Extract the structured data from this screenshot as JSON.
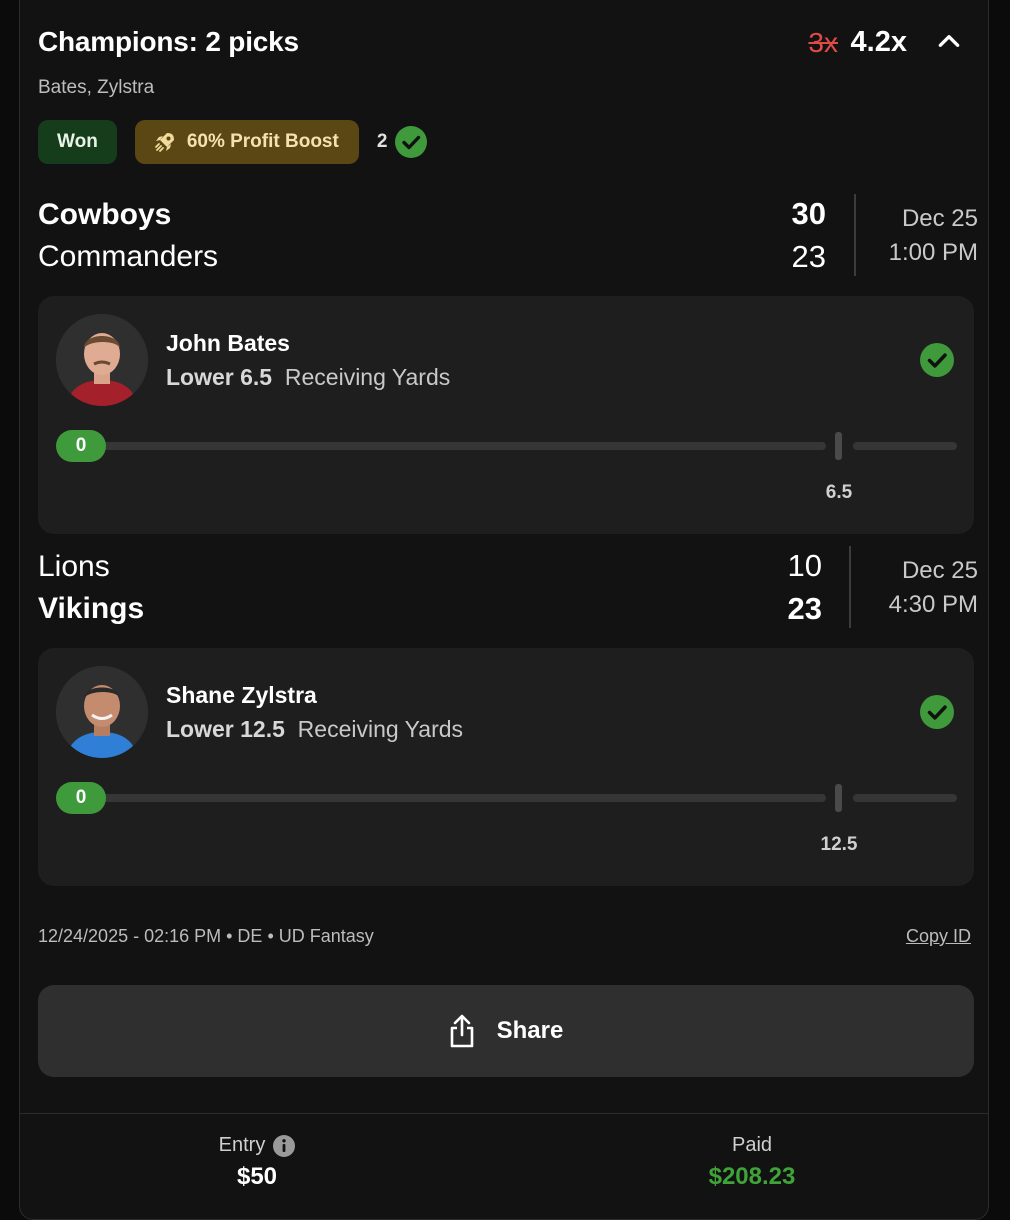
{
  "header": {
    "title": "Champions: 2 picks",
    "multiplier_old": "3x",
    "multiplier_new": "4.2x",
    "players_summary": "Bates, Zylstra"
  },
  "badges": {
    "status": "Won",
    "boost": "60% Profit Boost",
    "correct_count": "2"
  },
  "games": [
    {
      "team1": "Cowboys",
      "score1": "30",
      "team2": "Commanders",
      "score2": "23",
      "date": "Dec 25",
      "time": "1:00 PM",
      "winner": 1
    },
    {
      "team1": "Lions",
      "score1": "10",
      "team2": "Vikings",
      "score2": "23",
      "date": "Dec 25",
      "time": "4:30 PM",
      "winner": 2
    }
  ],
  "picks": [
    {
      "player": "John Bates",
      "direction_line": "Lower 6.5",
      "stat": "Receiving Yards",
      "actual": "0",
      "line_label": "6.5",
      "result": "check"
    },
    {
      "player": "Shane Zylstra",
      "direction_line": "Lower 12.5",
      "stat": "Receiving Yards",
      "actual": "0",
      "line_label": "12.5",
      "result": "check"
    }
  ],
  "meta": {
    "timestamp": "12/24/2025 - 02:16 PM • DE • UD Fantasy",
    "copy_id": "Copy ID"
  },
  "share_label": "Share",
  "footer": {
    "entry_label": "Entry",
    "entry_value": "$50",
    "paid_label": "Paid",
    "paid_value": "$208.23"
  },
  "colors": {
    "won_green": "#3f9a3b",
    "paid_green": "#3fa33a",
    "strike_red": "#e24b44",
    "boost_gold": "#5a4714"
  }
}
